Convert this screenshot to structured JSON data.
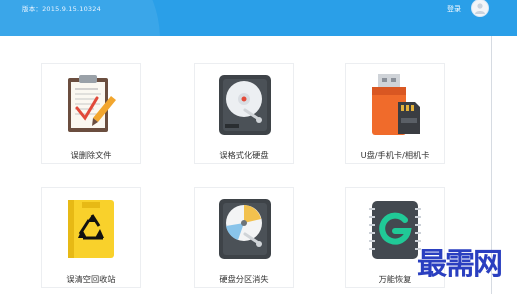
{
  "header": {
    "version_text": "版本：2015.9.15.10324",
    "login_label": "登录"
  },
  "tiles": [
    {
      "label": "误删除文件",
      "icon": "clipboard-document-icon"
    },
    {
      "label": "误格式化硬盘",
      "icon": "hard-disk-icon"
    },
    {
      "label": "U盘/手机卡/相机卡",
      "icon": "usb-sd-card-icon"
    },
    {
      "label": "误清空回收站",
      "icon": "recycle-bin-icon"
    },
    {
      "label": "硬盘分区消失",
      "icon": "partition-disk-icon"
    },
    {
      "label": "万能恢复",
      "icon": "universal-recovery-icon"
    }
  ],
  "watermark": "最需网",
  "colors": {
    "header": "#2a9fe8",
    "accent_orange": "#f06b2b",
    "recycle_yellow": "#f9d12b",
    "recovery_green": "#20c997"
  }
}
